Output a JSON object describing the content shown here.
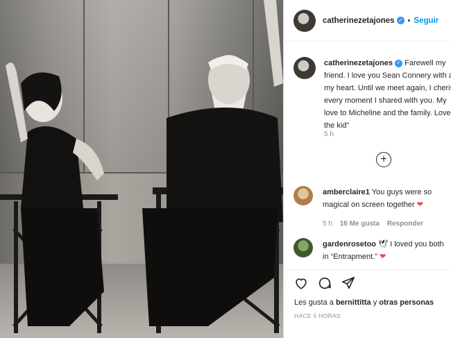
{
  "post": {
    "username": "catherinezetajones",
    "follow_label": "Seguir",
    "separator": "•",
    "caption_text": " Farewell my friend. I love you Sean Connery with all my heart. Until we meet again, I cherish every moment I shared with you. My love to Micheline and the family. Love “ the kid”",
    "caption_time": "5 h"
  },
  "comments": [
    {
      "username": "amberclaire1",
      "text": " You guys were so magical on screen together",
      "emoji": "❤",
      "time": "5 h",
      "likes": "16 Me gusta",
      "reply": "Responder"
    },
    {
      "username": "gardenrosetoo",
      "emoji_prefix": "🕊",
      "text": " I loved you both in “Entrapment.”",
      "emoji": "❤"
    }
  ],
  "likes": {
    "prefix": "Les gusta a ",
    "user": "bernittitta",
    "middle": " y ",
    "others": "otras personas"
  },
  "post_age": "HACE 5 HORAS",
  "icons": [
    "heart-icon",
    "comment-icon",
    "share-icon",
    "add-comments-icon",
    "verified-icon"
  ],
  "colors": {
    "link": "#0095f6",
    "verified": "#3897f0",
    "muted": "#8e8e8e",
    "heart": "#ed4956"
  }
}
